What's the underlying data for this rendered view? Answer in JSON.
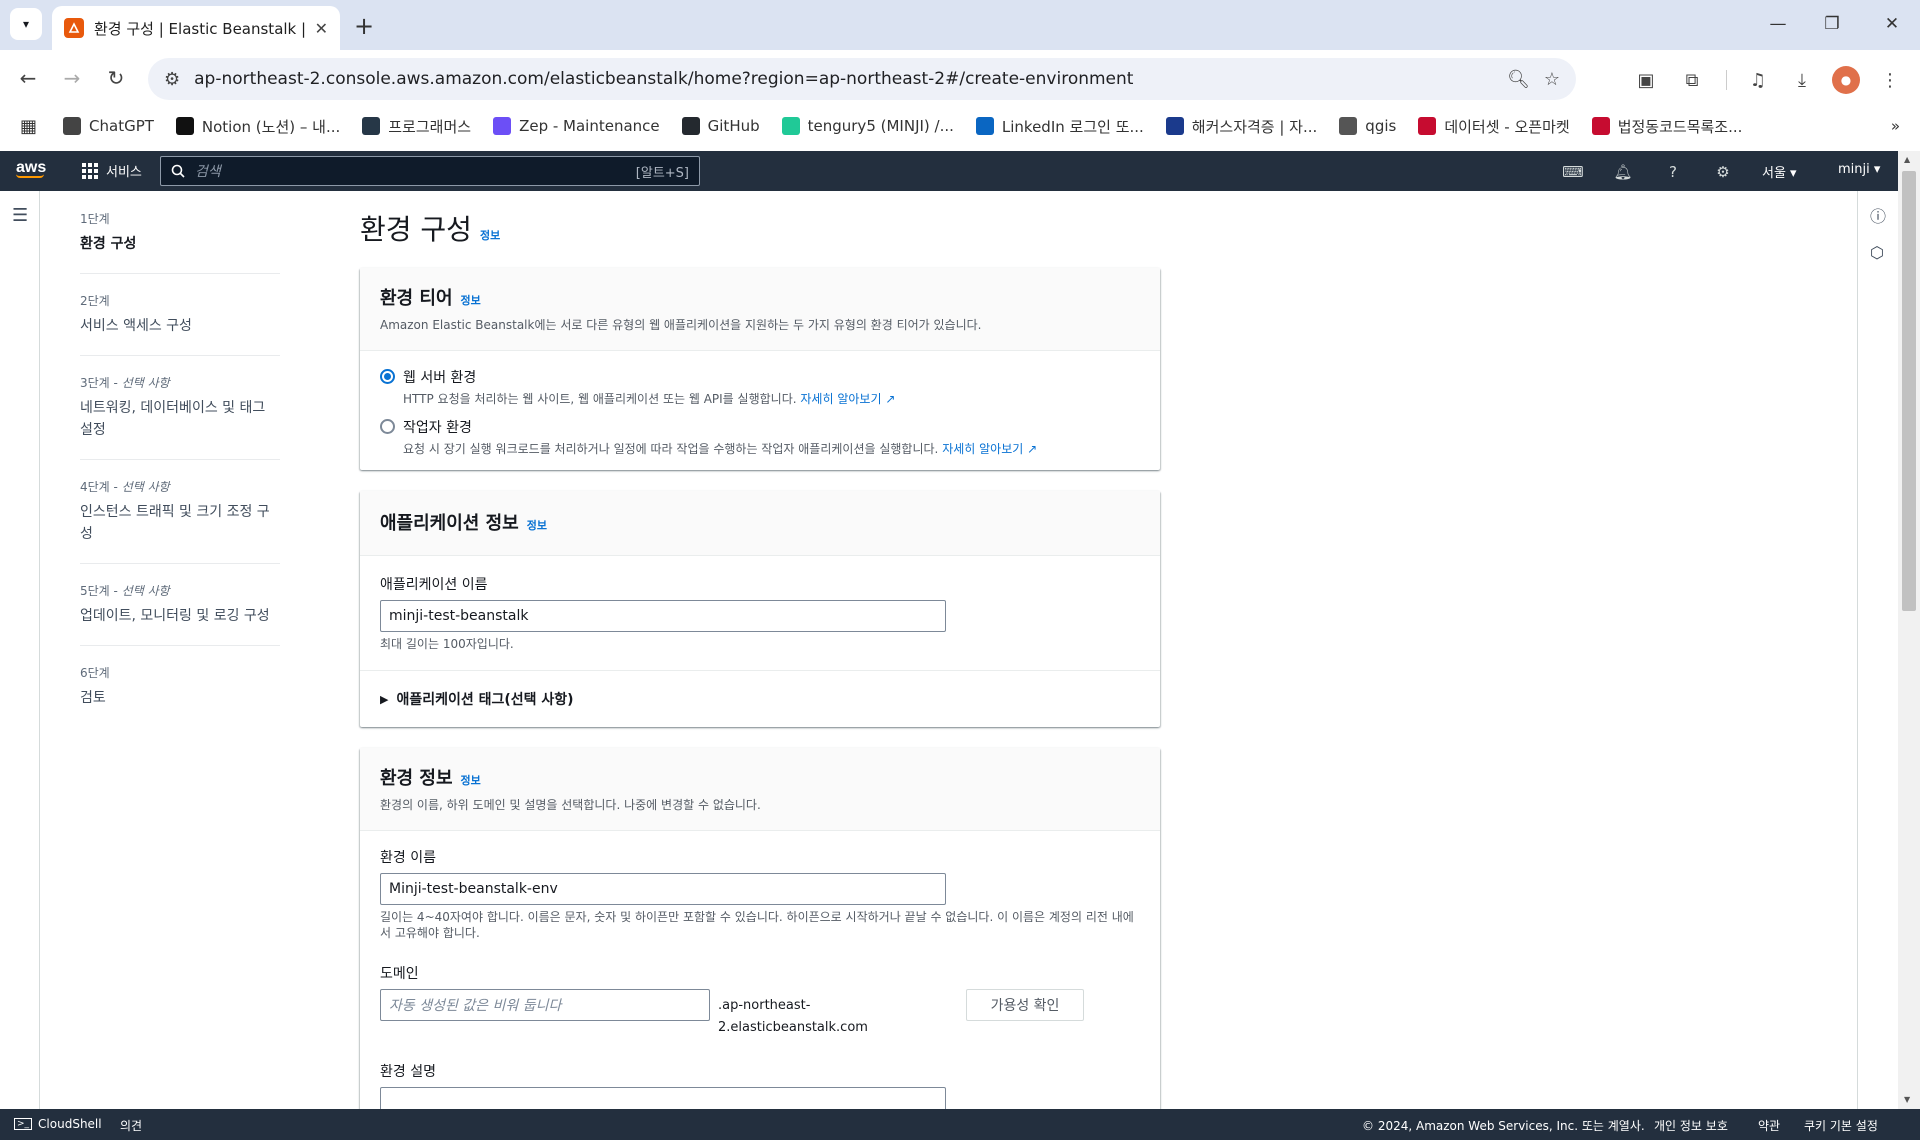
{
  "browser": {
    "tab_title": "환경 구성 | Elastic Beanstalk | a",
    "url": "ap-northeast-2.console.aws.amazon.com/elasticbeanstalk/home?region=ap-northeast-2#/create-environment",
    "bookmarks": [
      {
        "label": "ChatGPT",
        "icon": "chatgpt-icon",
        "color": "#444444"
      },
      {
        "label": "Notion (노션) – 내...",
        "icon": "notion-icon",
        "color": "#111111"
      },
      {
        "label": "프로그래머스",
        "icon": "programmers-icon",
        "color": "#263747"
      },
      {
        "label": "Zep - Maintenance",
        "icon": "zep-icon",
        "color": "#6c4ff6"
      },
      {
        "label": "GitHub",
        "icon": "github-icon",
        "color": "#24292f"
      },
      {
        "label": "tengury5 (MINJI) /...",
        "icon": "velog-icon",
        "color": "#20c997"
      },
      {
        "label": "LinkedIn 로그인 또...",
        "icon": "linkedin-icon",
        "color": "#0a66c2"
      },
      {
        "label": "해커스자격증 | 자...",
        "icon": "hackers-icon",
        "color": "#1b3a8c"
      },
      {
        "label": "qgis",
        "icon": "folder-icon",
        "color": "#555555"
      },
      {
        "label": "데이터셋 - 오픈마켓",
        "icon": "korea-gov-icon",
        "color": "#c60c30"
      },
      {
        "label": "법정동코드목록조...",
        "icon": "korea-gov-icon",
        "color": "#c60c30"
      }
    ]
  },
  "aws": {
    "logo": "aws",
    "services": "서비스",
    "search_placeholder": "검색",
    "search_shortcut": "[알트+S]",
    "region": "서울 ▾",
    "user": "minji ▾"
  },
  "steps": [
    {
      "num": "1단계",
      "opt": "",
      "label": "환경 구성",
      "current": true
    },
    {
      "num": "2단계",
      "opt": "",
      "label": "서비스 액세스 구성",
      "current": false
    },
    {
      "num": "3단계 - ",
      "opt": "선택 사항",
      "label": "네트워킹, 데이터베이스 및 태그 설정",
      "current": false
    },
    {
      "num": "4단계 - ",
      "opt": "선택 사항",
      "label": "인스턴스 트래픽 및 크기 조정 구성",
      "current": false
    },
    {
      "num": "5단계 - ",
      "opt": "선택 사항",
      "label": "업데이트, 모니터링 및 로깅 구성",
      "current": false
    },
    {
      "num": "6단계",
      "opt": "",
      "label": "검토",
      "current": false
    }
  ],
  "page": {
    "title": "환경 구성",
    "info": "정보",
    "tier": {
      "title": "환경 티어",
      "desc": "Amazon Elastic Beanstalk에는 서로 다른 유형의 웹 애플리케이션을 지원하는 두 가지 유형의 환경 티어가 있습니다.",
      "web_label": "웹 서버 환경",
      "web_desc": "HTTP 요청을 처리하는 웹 사이트, 웹 애플리케이션 또는 웹 API를 실행합니다.",
      "worker_label": "작업자 환경",
      "worker_desc": "요청 시 장기 실행 워크로드를 처리하거나 일정에 따라 작업을 수행하는 작업자 애플리케이션을 실행합니다.",
      "learn_more": "자세히 알아보기"
    },
    "app": {
      "title": "애플리케이션 정보",
      "name_label": "애플리케이션 이름",
      "name_value": "minji-test-beanstalk",
      "name_hint": "최대 길이는 100자입니다.",
      "tags": "애플리케이션 태그(선택 사항)"
    },
    "env": {
      "title": "환경 정보",
      "desc": "환경의 이름, 하위 도메인 및 설명을 선택합니다. 나중에 변경할 수 없습니다.",
      "name_label": "환경 이름",
      "name_value": "Minji-test-beanstalk-env",
      "name_hint": "길이는 4~40자여야 합니다. 이름은 문자, 숫자 및 하이픈만 포함할 수 있습니다. 하이픈으로 시작하거나 끝날 수 없습니다. 이 이름은 계정의 리전 내에서 고유해야 합니다.",
      "domain_label": "도메인",
      "domain_placeholder": "자동 생성된 값은 비워 둡니다",
      "domain_suffix_1": ".ap-northeast-",
      "domain_suffix_2": "2.elasticbeanstalk.com",
      "check_button": "가용성 확인",
      "desc_label": "환경 설명"
    }
  },
  "footer": {
    "cloudshell": "CloudShell",
    "feedback": "의견",
    "copyright": "© 2024, Amazon Web Services, Inc. 또는 계열사.",
    "privacy": "개인 정보 보호",
    "terms": "약관",
    "cookies": "쿠키 기본 설정"
  }
}
